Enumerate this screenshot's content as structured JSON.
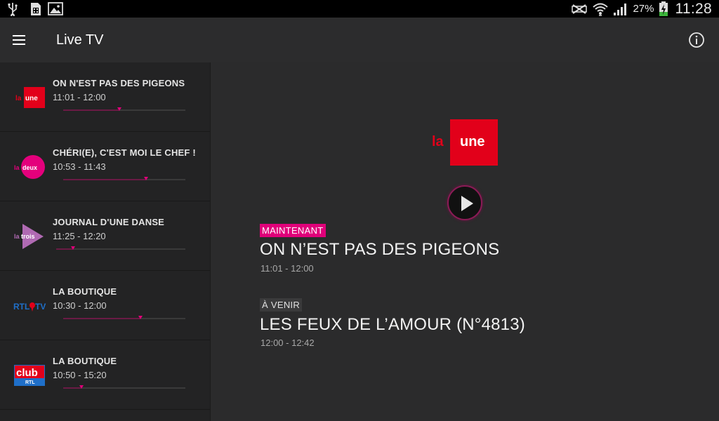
{
  "status_bar": {
    "battery_percent": "27%",
    "time": "11:28",
    "icons": [
      "usb-icon",
      "sim-icon",
      "image-icon",
      "mute-icon",
      "wifi-icon",
      "signal-icon",
      "battery-charging-icon"
    ]
  },
  "app_bar": {
    "title": "Live TV",
    "menu_icon": "hamburger-menu-icon",
    "info_icon": "info-icon"
  },
  "channels": [
    {
      "logo": "la une",
      "title": "ON N'EST PAS DES PIGEONS",
      "time": "11:01 - 12:00",
      "progress": 0.46
    },
    {
      "logo": "la deux",
      "title": "CHÉRI(E), C'EST MOI LE CHEF !",
      "time": "10:53 - 11:43",
      "progress": 0.68
    },
    {
      "logo": "la trois",
      "title": "JOURNAL D'UNE DANSE",
      "time": "11:25 - 12:20",
      "progress": 0.13
    },
    {
      "logo": "RTL TVI",
      "title": "LA BOUTIQUE",
      "time": "10:30 - 12:00",
      "progress": 0.63
    },
    {
      "logo": "club RTL",
      "title": "LA BOUTIQUE",
      "time": "10:50 - 15:20",
      "progress": 0.15
    }
  ],
  "detail": {
    "logo": "la une",
    "play_icon": "play-icon",
    "now": {
      "badge": "MAINTENANT",
      "title": "ON N’EST PAS DES PIGEONS",
      "time": "11:01 - 12:00"
    },
    "next": {
      "badge": "À VENIR",
      "title": "LES FEUX DE L’AMOUR (N°4813)",
      "time": "12:00 - 12:42"
    }
  },
  "colors": {
    "accent": "#e0007a",
    "background": "#2b2b2c",
    "sidebar": "#232324",
    "la_une_red": "#e2001a"
  }
}
